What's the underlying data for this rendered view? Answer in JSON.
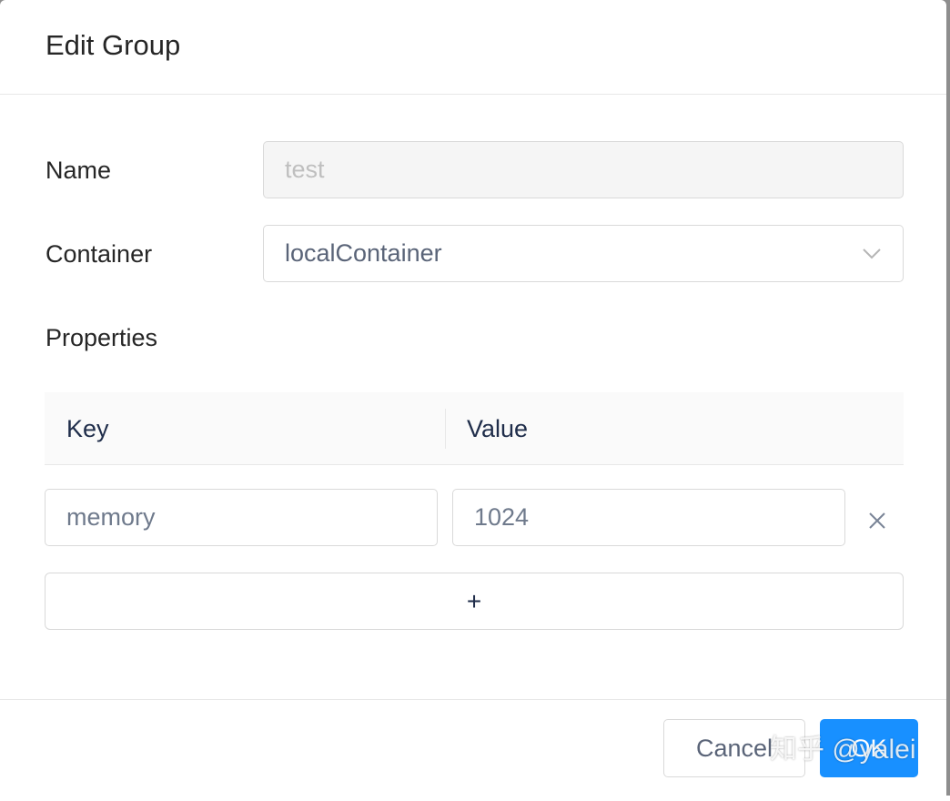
{
  "dialog": {
    "title": "Edit Group"
  },
  "form": {
    "name_label": "Name",
    "name_value": "test",
    "container_label": "Container",
    "container_value": "localContainer",
    "properties_label": "Properties"
  },
  "properties_table": {
    "columns": [
      "Key",
      "Value"
    ],
    "rows": [
      {
        "key": "memory",
        "value": "1024"
      }
    ],
    "add_label": "+"
  },
  "footer": {
    "cancel_label": "Cancel",
    "ok_label": "OK"
  },
  "watermark": "知乎 @yalei",
  "colors": {
    "primary": "#1890ff",
    "border": "#d9d9d9",
    "disabled_bg": "#f5f5f5",
    "header_bg": "#fafafa"
  },
  "icons": {
    "select_arrow": "chevron-down-icon",
    "remove_row": "close-icon"
  }
}
